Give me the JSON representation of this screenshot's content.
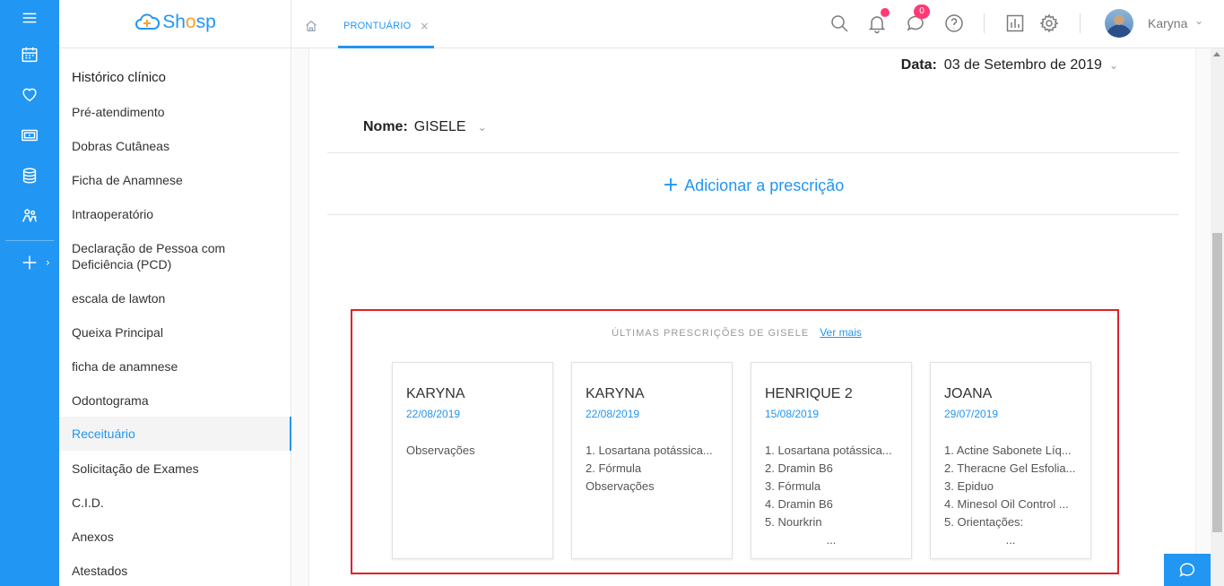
{
  "brand": {
    "name_prefix": "Sh",
    "name_o": "o",
    "name_suffix": "sp"
  },
  "tabs": [
    {
      "label": "PRONTUÁRIO",
      "close": "×"
    }
  ],
  "header": {
    "message_count": "0",
    "user_name": "Karyna",
    "user_chevron": "⌄"
  },
  "menu": {
    "items": [
      {
        "label": "Histórico clínico"
      },
      {
        "label": "Pré-atendimento"
      },
      {
        "label": "Dobras Cutâneas"
      },
      {
        "label": "Ficha de Anamnese"
      },
      {
        "label": "Intraoperatório"
      },
      {
        "label": "Declaração de Pessoa com Deficiência (PCD)"
      },
      {
        "label": "escala de lawton"
      },
      {
        "label": "Queixa Principal"
      },
      {
        "label": "ficha de anamnese"
      },
      {
        "label": "Odontograma"
      },
      {
        "label": "Receituário"
      },
      {
        "label": "Solicitação de Exames"
      },
      {
        "label": "C.I.D."
      },
      {
        "label": "Anexos"
      },
      {
        "label": "Atestados"
      }
    ],
    "active": "Receituário"
  },
  "form": {
    "date_label": "Data:",
    "date_value": "03 de Setembro de 2019",
    "name_label": "Nome:",
    "name_value": "GISELE",
    "chevron": "⌄",
    "add_plus": "+",
    "add_label": "Adicionar a prescrição"
  },
  "recent": {
    "title": "ÚLTIMAS PRESCRIÇÕES DE GISELE",
    "more_link": "Ver mais",
    "cards": [
      {
        "name": "KARYNA",
        "date": "22/08/2019",
        "lines": [
          "Observações"
        ],
        "more": ""
      },
      {
        "name": "KARYNA",
        "date": "22/08/2019",
        "lines": [
          "1. Losartana potássica...",
          "2. Fórmula",
          "Observações"
        ],
        "more": ""
      },
      {
        "name": "HENRIQUE 2",
        "date": "15/08/2019",
        "lines": [
          "1. Losartana potássica...",
          "2. Dramin B6",
          "3. Fórmula",
          "4. Dramin B6",
          "5. Nourkrin"
        ],
        "more": "..."
      },
      {
        "name": "JOANA",
        "date": "29/07/2019",
        "lines": [
          "1. Actine Sabonete Líq...",
          "2. Theracne Gel Esfolia...",
          "3. Epiduo",
          "4. Minesol Oil Control ...",
          "5. Orientações:"
        ],
        "more": "..."
      }
    ]
  },
  "colors": {
    "primary": "#2196f3",
    "accent_orange": "#f5a623",
    "alert": "#ff3a74",
    "highlight_border": "#e0202a"
  },
  "icons": [
    "menu-icon",
    "calendar-icon",
    "heart-icon",
    "money-icon",
    "database-icon",
    "users-icon",
    "plus-icon",
    "home-icon",
    "search-icon",
    "bell-icon",
    "chat-icon",
    "help-icon",
    "chart-icon",
    "gear-icon",
    "chat-support-icon"
  ]
}
